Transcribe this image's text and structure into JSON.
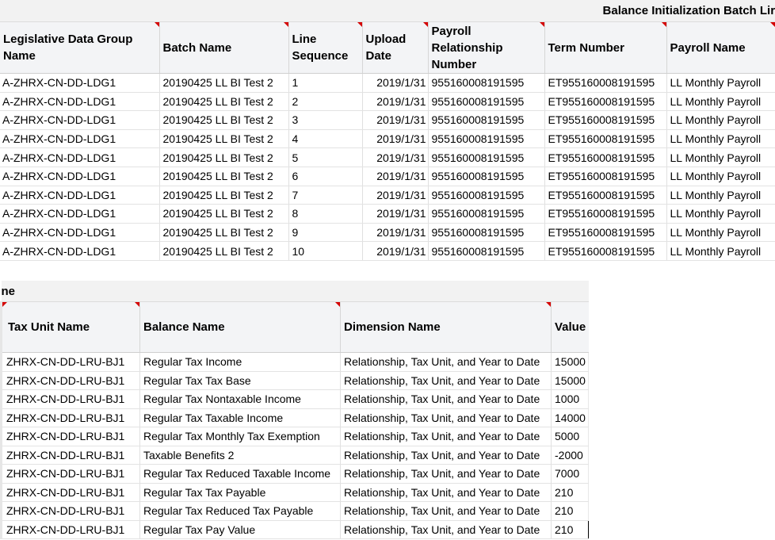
{
  "top": {
    "title": "Balance Initialization Batch Lir",
    "headers": [
      "Legislative Data Group Name",
      "Batch Name",
      "Line Sequence",
      "Upload Date",
      "Payroll Relationship Number",
      "Term Number",
      "Payroll Name"
    ],
    "rows": [
      [
        "A-ZHRX-CN-DD-LDG1",
        "20190425 LL BI Test 2",
        "1",
        "2019/1/31",
        "955160008191595",
        "ET955160008191595",
        "LL Monthly Payroll"
      ],
      [
        "A-ZHRX-CN-DD-LDG1",
        "20190425 LL BI Test 2",
        "2",
        "2019/1/31",
        "955160008191595",
        "ET955160008191595",
        "LL Monthly Payroll"
      ],
      [
        "A-ZHRX-CN-DD-LDG1",
        "20190425 LL BI Test 2",
        "3",
        "2019/1/31",
        "955160008191595",
        "ET955160008191595",
        "LL Monthly Payroll"
      ],
      [
        "A-ZHRX-CN-DD-LDG1",
        "20190425 LL BI Test 2",
        "4",
        "2019/1/31",
        "955160008191595",
        "ET955160008191595",
        "LL Monthly Payroll"
      ],
      [
        "A-ZHRX-CN-DD-LDG1",
        "20190425 LL BI Test 2",
        "5",
        "2019/1/31",
        "955160008191595",
        "ET955160008191595",
        "LL Monthly Payroll"
      ],
      [
        "A-ZHRX-CN-DD-LDG1",
        "20190425 LL BI Test 2",
        "6",
        "2019/1/31",
        "955160008191595",
        "ET955160008191595",
        "LL Monthly Payroll"
      ],
      [
        "A-ZHRX-CN-DD-LDG1",
        "20190425 LL BI Test 2",
        "7",
        "2019/1/31",
        "955160008191595",
        "ET955160008191595",
        "LL Monthly Payroll"
      ],
      [
        "A-ZHRX-CN-DD-LDG1",
        "20190425 LL BI Test 2",
        "8",
        "2019/1/31",
        "955160008191595",
        "ET955160008191595",
        "LL Monthly Payroll"
      ],
      [
        "A-ZHRX-CN-DD-LDG1",
        "20190425 LL BI Test 2",
        "9",
        "2019/1/31",
        "955160008191595",
        "ET955160008191595",
        "LL Monthly Payroll"
      ],
      [
        "A-ZHRX-CN-DD-LDG1",
        "20190425 LL BI Test 2",
        "10",
        "2019/1/31",
        "955160008191595",
        "ET955160008191595",
        "LL Monthly Payroll"
      ]
    ]
  },
  "bottom": {
    "title": "ne",
    "headers": [
      "Tax Unit Name",
      "Balance Name",
      "Dimension Name",
      "Value"
    ],
    "rows": [
      [
        "ZHRX-CN-DD-LRU-BJ1",
        "Regular Tax Income",
        "Relationship, Tax Unit, and Year to Date",
        "15000"
      ],
      [
        "ZHRX-CN-DD-LRU-BJ1",
        "Regular Tax Tax Base",
        "Relationship, Tax Unit, and Year to Date",
        "15000"
      ],
      [
        "ZHRX-CN-DD-LRU-BJ1",
        "Regular Tax Nontaxable Income",
        "Relationship, Tax Unit, and Year to Date",
        "1000"
      ],
      [
        "ZHRX-CN-DD-LRU-BJ1",
        "Regular Tax Taxable Income",
        "Relationship, Tax Unit, and Year to Date",
        "14000"
      ],
      [
        "ZHRX-CN-DD-LRU-BJ1",
        "Regular Tax Monthly Tax Exemption",
        "Relationship, Tax Unit, and Year to Date",
        "5000"
      ],
      [
        "ZHRX-CN-DD-LRU-BJ1",
        "Taxable Benefits 2",
        "Relationship, Tax Unit, and Year to Date",
        "-2000"
      ],
      [
        "ZHRX-CN-DD-LRU-BJ1",
        "Regular Tax Reduced Taxable Income",
        "Relationship, Tax Unit, and Year to Date",
        "7000"
      ],
      [
        "ZHRX-CN-DD-LRU-BJ1",
        "Regular Tax Tax Payable",
        "Relationship, Tax Unit, and Year to Date",
        "210"
      ],
      [
        "ZHRX-CN-DD-LRU-BJ1",
        "Regular Tax Reduced Tax Payable",
        "Relationship, Tax Unit, and Year to Date",
        "210"
      ],
      [
        "ZHRX-CN-DD-LRU-BJ1",
        "Regular Tax Pay Value",
        "Relationship, Tax Unit, and Year to Date",
        "210"
      ]
    ]
  },
  "colors": {
    "comment_marker": "#d40000",
    "header_bg": "#f3f4f6"
  },
  "icons": {
    "comment_marker": "comment-indicator-icon"
  }
}
